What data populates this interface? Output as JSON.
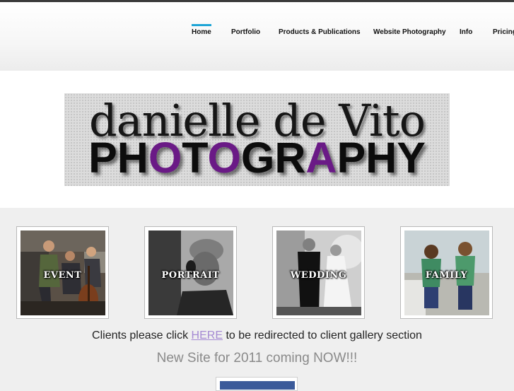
{
  "nav": {
    "items": [
      {
        "label": "Home",
        "active": true
      },
      {
        "label": "Portfolio"
      },
      {
        "label": "Products & Publications"
      },
      {
        "label": "Website Photography"
      },
      {
        "label": "Info"
      },
      {
        "label": "Pricing"
      }
    ],
    "active_color": "#1fa5d6"
  },
  "banner": {
    "line1": "danielle de Vito",
    "line2": "PHOTOGRAPHY",
    "accent_color": "#6a1a86"
  },
  "galleries": [
    {
      "label": "EVENT"
    },
    {
      "label": "PORTRAIT"
    },
    {
      "label": "WEDDING"
    },
    {
      "label": "FAMILY"
    }
  ],
  "clients": {
    "before": "Clients please click ",
    "link": "HERE",
    "after": " to be redirected to client gallery section"
  },
  "announcement": "New Site for 2011 coming NOW!!!"
}
